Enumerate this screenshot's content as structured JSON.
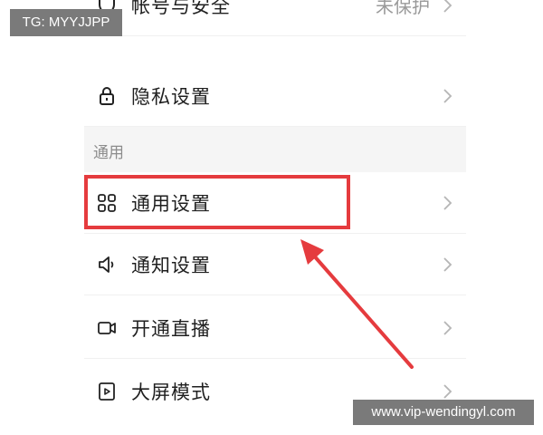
{
  "settings_list": {
    "account_row": {
      "label": "帐号与安全",
      "value": "未保护",
      "icon": "shield-icon"
    },
    "privacy_row": {
      "label": "隐私设置",
      "icon": "lock-icon"
    },
    "section_general": {
      "title": "通用"
    },
    "general_row": {
      "label": "通用设置",
      "icon": "grid-icon"
    },
    "notify_row": {
      "label": "通知设置",
      "icon": "speaker-icon"
    },
    "live_row": {
      "label": "开通直播",
      "icon": "video-camera-icon"
    },
    "screen_row": {
      "label": "大屏模式",
      "icon": "play-screen-icon"
    }
  },
  "overlays": {
    "tg_badge": "TG: MYYJJPP",
    "site_badge": "www.vip-wendingyl.com",
    "highlight_color": "#e53b3e"
  }
}
